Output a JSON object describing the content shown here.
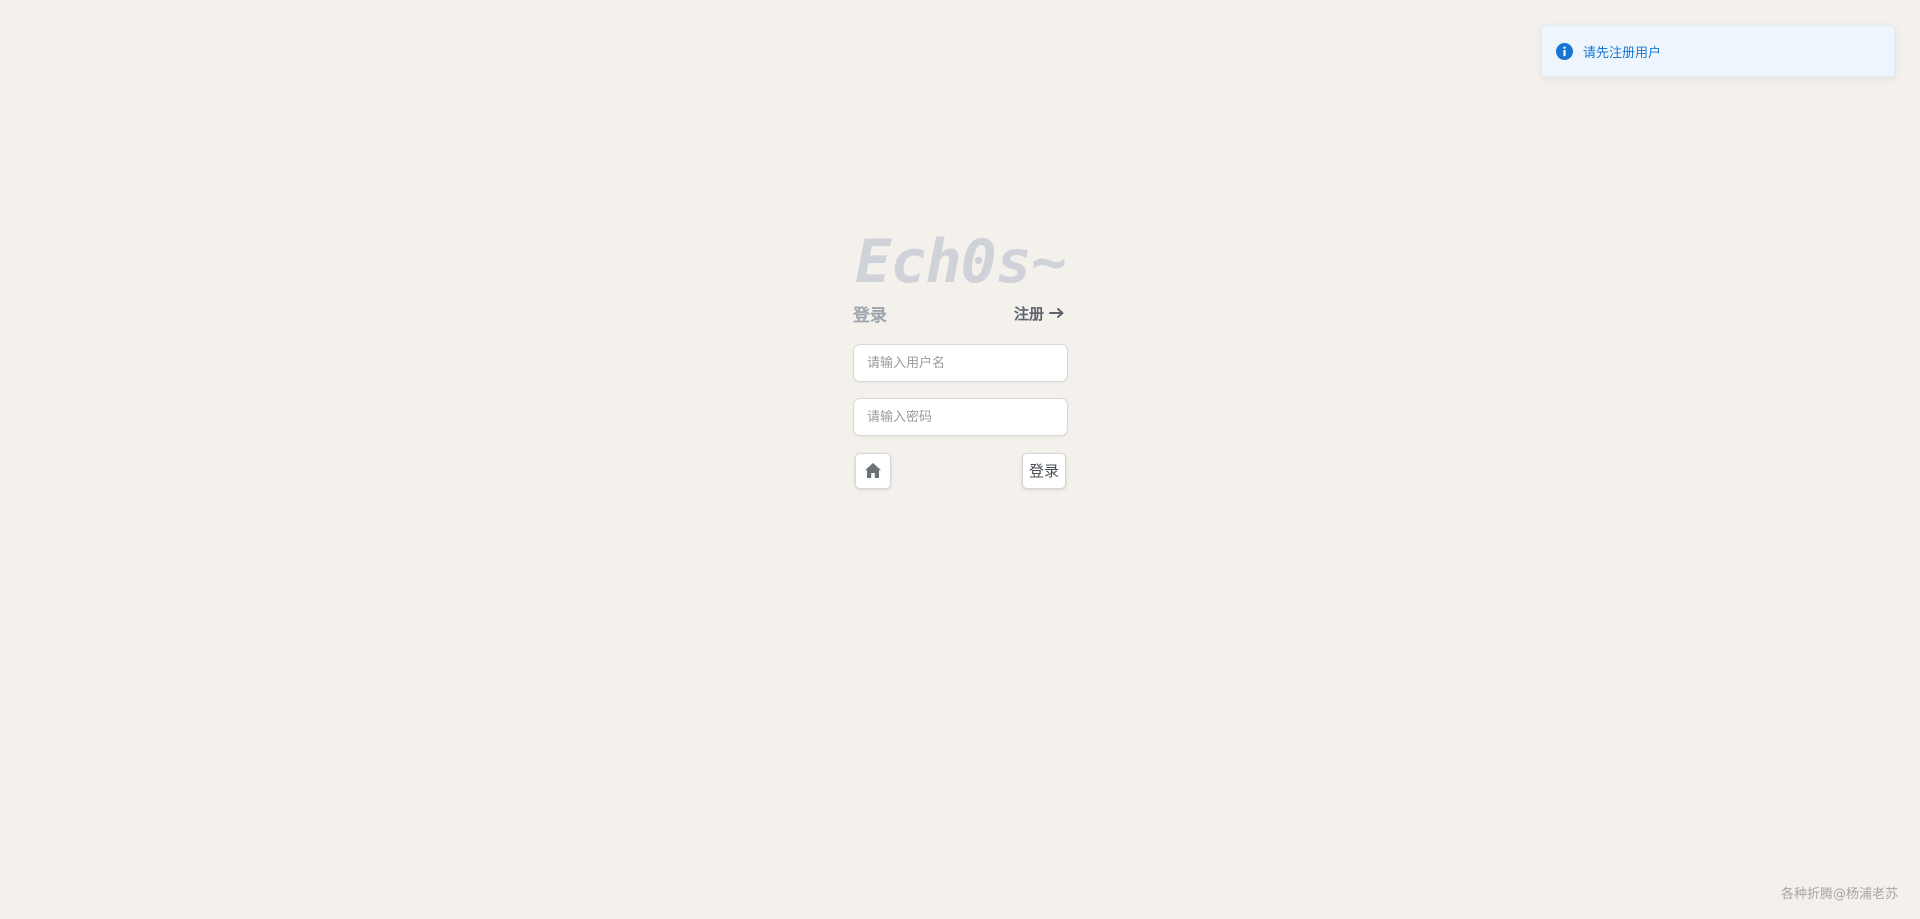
{
  "toast": {
    "icon": "info-circle-icon",
    "message": "请先注册用户",
    "color": "#1677d2"
  },
  "login": {
    "logo": "Ech0s~",
    "tab_login": "登录",
    "tab_register": "注册",
    "register_icon": "arrow-right-icon",
    "username_placeholder": "请输入用户名",
    "password_placeholder": "请输入密码",
    "home_icon": "home-icon",
    "submit_label": "登录"
  },
  "footer": {
    "text": "各种折腾@杨浦老苏"
  }
}
